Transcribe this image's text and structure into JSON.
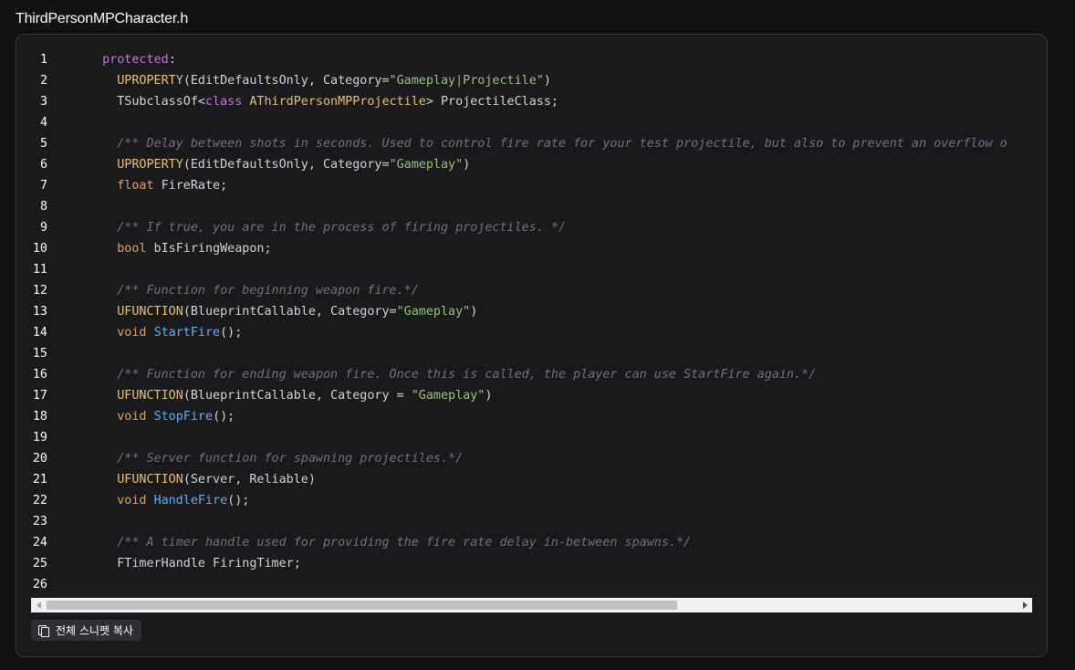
{
  "file": {
    "name": "ThirdPersonMPCharacter.h"
  },
  "code": {
    "lines": [
      {
        "n": "1",
        "tokens": [
          {
            "t": "  ",
            "k": "plain"
          },
          {
            "t": "protected",
            "k": "keyword"
          },
          {
            "t": ":",
            "k": "punct"
          }
        ]
      },
      {
        "n": "2",
        "tokens": [
          {
            "t": "    ",
            "k": "plain"
          },
          {
            "t": "UPROPERTY",
            "k": "macro"
          },
          {
            "t": "(EditDefaultsOnly, Category=",
            "k": "plain"
          },
          {
            "t": "\"Gameplay|Projectile\"",
            "k": "string"
          },
          {
            "t": ")",
            "k": "plain"
          }
        ]
      },
      {
        "n": "3",
        "tokens": [
          {
            "t": "    TSubclassOf<",
            "k": "plain"
          },
          {
            "t": "class",
            "k": "keyword"
          },
          {
            "t": " ",
            "k": "plain"
          },
          {
            "t": "AThirdPersonMPProjectile",
            "k": "class"
          },
          {
            "t": "> ProjectileClass;",
            "k": "plain"
          }
        ]
      },
      {
        "n": "4",
        "tokens": []
      },
      {
        "n": "5",
        "tokens": [
          {
            "t": "    ",
            "k": "plain"
          },
          {
            "t": "/** Delay between shots in seconds. Used to control fire rate for your test projectile, but also to prevent an overflow o",
            "k": "comment"
          }
        ]
      },
      {
        "n": "6",
        "tokens": [
          {
            "t": "    ",
            "k": "plain"
          },
          {
            "t": "UPROPERTY",
            "k": "macro"
          },
          {
            "t": "(EditDefaultsOnly, Category=",
            "k": "plain"
          },
          {
            "t": "\"Gameplay\"",
            "k": "string"
          },
          {
            "t": ")",
            "k": "plain"
          }
        ]
      },
      {
        "n": "7",
        "tokens": [
          {
            "t": "    ",
            "k": "plain"
          },
          {
            "t": "float",
            "k": "type"
          },
          {
            "t": " FireRate;",
            "k": "plain"
          }
        ]
      },
      {
        "n": "8",
        "tokens": []
      },
      {
        "n": "9",
        "tokens": [
          {
            "t": "    ",
            "k": "plain"
          },
          {
            "t": "/** If true, you are in the process of firing projectiles. */",
            "k": "comment"
          }
        ]
      },
      {
        "n": "10",
        "tokens": [
          {
            "t": "    ",
            "k": "plain"
          },
          {
            "t": "bool",
            "k": "type"
          },
          {
            "t": " bIsFiringWeapon;",
            "k": "plain"
          }
        ]
      },
      {
        "n": "11",
        "tokens": []
      },
      {
        "n": "12",
        "tokens": [
          {
            "t": "    ",
            "k": "plain"
          },
          {
            "t": "/** Function for beginning weapon fire.*/",
            "k": "comment"
          }
        ]
      },
      {
        "n": "13",
        "tokens": [
          {
            "t": "    ",
            "k": "plain"
          },
          {
            "t": "UFUNCTION",
            "k": "macro"
          },
          {
            "t": "(BlueprintCallable, Category=",
            "k": "plain"
          },
          {
            "t": "\"Gameplay\"",
            "k": "string"
          },
          {
            "t": ")",
            "k": "plain"
          }
        ]
      },
      {
        "n": "14",
        "tokens": [
          {
            "t": "    ",
            "k": "plain"
          },
          {
            "t": "void",
            "k": "type"
          },
          {
            "t": " ",
            "k": "plain"
          },
          {
            "t": "StartFire",
            "k": "function"
          },
          {
            "t": "();",
            "k": "plain"
          }
        ]
      },
      {
        "n": "15",
        "tokens": []
      },
      {
        "n": "16",
        "tokens": [
          {
            "t": "    ",
            "k": "plain"
          },
          {
            "t": "/** Function for ending weapon fire. Once this is called, the player can use StartFire again.*/",
            "k": "comment"
          }
        ]
      },
      {
        "n": "17",
        "tokens": [
          {
            "t": "    ",
            "k": "plain"
          },
          {
            "t": "UFUNCTION",
            "k": "macro"
          },
          {
            "t": "(BlueprintCallable, Category = ",
            "k": "plain"
          },
          {
            "t": "\"Gameplay\"",
            "k": "string"
          },
          {
            "t": ")",
            "k": "plain"
          }
        ]
      },
      {
        "n": "18",
        "tokens": [
          {
            "t": "    ",
            "k": "plain"
          },
          {
            "t": "void",
            "k": "type"
          },
          {
            "t": " ",
            "k": "plain"
          },
          {
            "t": "StopFire",
            "k": "function"
          },
          {
            "t": "();",
            "k": "plain"
          }
        ]
      },
      {
        "n": "19",
        "tokens": []
      },
      {
        "n": "20",
        "tokens": [
          {
            "t": "    ",
            "k": "plain"
          },
          {
            "t": "/** Server function for spawning projectiles.*/",
            "k": "comment"
          }
        ]
      },
      {
        "n": "21",
        "tokens": [
          {
            "t": "    ",
            "k": "plain"
          },
          {
            "t": "UFUNCTION",
            "k": "macro"
          },
          {
            "t": "(Server, Reliable)",
            "k": "plain"
          }
        ]
      },
      {
        "n": "22",
        "tokens": [
          {
            "t": "    ",
            "k": "plain"
          },
          {
            "t": "void",
            "k": "type"
          },
          {
            "t": " ",
            "k": "plain"
          },
          {
            "t": "HandleFire",
            "k": "function"
          },
          {
            "t": "();",
            "k": "plain"
          }
        ]
      },
      {
        "n": "23",
        "tokens": []
      },
      {
        "n": "24",
        "tokens": [
          {
            "t": "    ",
            "k": "plain"
          },
          {
            "t": "/** A timer handle used for providing the fire rate delay in-between spawns.*/",
            "k": "comment"
          }
        ]
      },
      {
        "n": "25",
        "tokens": [
          {
            "t": "    FTimerHandle FiringTimer;",
            "k": "plain"
          }
        ]
      },
      {
        "n": "26",
        "tokens": []
      }
    ]
  },
  "scrollbar": {
    "horizontal_position": 0,
    "visible_fraction": 0.65
  },
  "actions": {
    "copy_label": "전체 스니펫 복사"
  },
  "colors": {
    "background": "#121214",
    "panel": "#1a1a1d",
    "keyword": "#c678dd",
    "macro": "#e5c07b",
    "type": "#e0a369",
    "string": "#98c379",
    "comment": "#6b7280",
    "function": "#61afef"
  },
  "icons": {
    "copy": "copy-icon",
    "scroll_left": "arrow-left-icon",
    "scroll_right": "arrow-right-icon"
  }
}
